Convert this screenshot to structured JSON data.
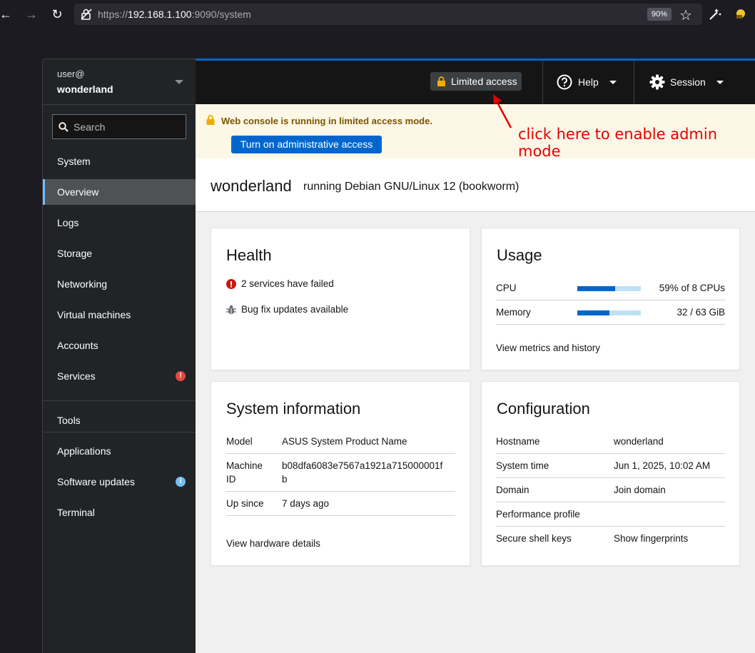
{
  "browser": {
    "url_prefix": "https://",
    "url_host": "192.168.1.100",
    "url_rest": ":9090/system",
    "zoom": "90%"
  },
  "sidebar": {
    "user": "user@",
    "host": "wonderland",
    "search_placeholder": "Search",
    "group_system": "System",
    "items_system": [
      {
        "label": "Overview"
      },
      {
        "label": "Logs"
      },
      {
        "label": "Storage"
      },
      {
        "label": "Networking"
      },
      {
        "label": "Virtual machines"
      },
      {
        "label": "Accounts"
      },
      {
        "label": "Services",
        "badge": "!"
      }
    ],
    "group_tools": "Tools",
    "items_tools": [
      {
        "label": "Applications"
      },
      {
        "label": "Software updates",
        "badge": "i"
      },
      {
        "label": "Terminal"
      }
    ]
  },
  "masthead": {
    "limited_access": "Limited access",
    "help": "Help",
    "session": "Session"
  },
  "alert": {
    "title": "Web console is running in limited access mode.",
    "button": "Turn on administrative access"
  },
  "annotation": {
    "text": "click here to enable admin mode",
    "color": "#e60000"
  },
  "page_header": {
    "hostname": "wonderland",
    "os": "running Debian GNU/Linux 12 (bookworm)"
  },
  "health": {
    "title": "Health",
    "failed_link": "2 services have failed",
    "updates_link": "Bug fix updates available"
  },
  "usage": {
    "title": "Usage",
    "cpu_label": "CPU",
    "cpu_value": "59% of 8 CPUs",
    "cpu_fraction": 0.59,
    "memory_label": "Memory",
    "memory_value": "32 / 63 GiB",
    "memory_fraction": 0.51,
    "metrics_link": "View metrics and history"
  },
  "system_info": {
    "title": "System information",
    "model_label": "Model",
    "model_value": "ASUS System Product Name",
    "machine_id_label_1": "Machine",
    "machine_id_label_2": "ID",
    "machine_id_1": "b08dfa6083e7567a1921a715000001f",
    "machine_id_2": "b",
    "uptime_label": "Up since",
    "uptime_value": "7 days ago",
    "hardware_link": "View hardware details"
  },
  "configuration": {
    "title": "Configuration",
    "hostname_label": "Hostname",
    "hostname_value": "wonderland",
    "time_label": "System time",
    "time_value": "Jun 1, 2025, 10:02 AM",
    "domain_label": "Domain",
    "domain_value": "Join domain",
    "profile_label": "Performance profile",
    "ssh_label": "Secure shell keys",
    "ssh_link": "Show fingerprints"
  }
}
